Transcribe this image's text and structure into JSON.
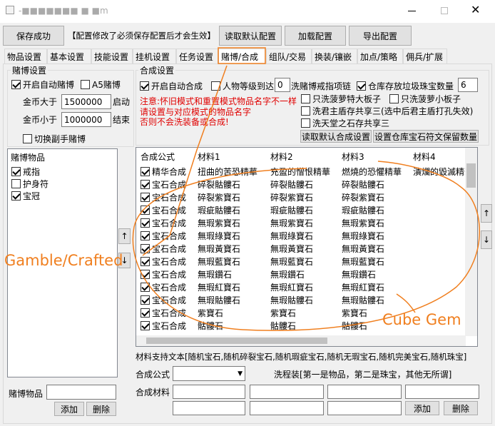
{
  "window": {
    "title": "-■■■■■■■ ■ ■m"
  },
  "toolbar": {
    "save_success": "保存成功",
    "notice": "【配置修改了必须保存配置后才会生效】",
    "read_default": "读取默认配置",
    "load_config": "加载配置",
    "export_config": "导出配置"
  },
  "tabs": [
    "物品设置",
    "基本设置",
    "技能设置",
    "挂机设置",
    "任务设置",
    "赌博/合成",
    "组队/交易",
    "换装/镶嵌",
    "加点/策略",
    "佣兵/扩展"
  ],
  "gamble": {
    "group_title": "赌博设置",
    "auto_gamble": "开启自动赌博",
    "a5_gamble": "A5赌博",
    "gold_gt_label": "金币大于",
    "gold_gt_value": "1500000",
    "start_label": "启动",
    "gold_lt_label": "金币小于",
    "gold_lt_value": "1000000",
    "end_label": "结束",
    "switch_weapon": "切换副手赌博",
    "items_header": "赌博物品",
    "items": [
      {
        "label": "戒指",
        "checked": true
      },
      {
        "label": "护身符",
        "checked": false
      },
      {
        "label": "宝冠",
        "checked": true
      }
    ],
    "item_label": "赌博物品",
    "add": "添加",
    "delete": "删除"
  },
  "craft": {
    "group_title": "合成设置",
    "auto_craft": "开启自动合成",
    "level_label": "人物等级到达",
    "level_value": "0",
    "wash_ring": "洗赌博戒指项链",
    "stash_trash": "仓库存放垃圾珠宝数量",
    "stash_value": "6",
    "wash_big_belt": "只洗菠萝特大板子",
    "wash_small_belt": "只洗菠萝小板子",
    "wash_shield": "洗君主盾存共享三(选中后君主盾打孔失效)",
    "wash_stone": "洗天堂之石存共享三",
    "warn1": "注意:怀旧模式和重置模式物品名字不一样",
    "warn2": "请设置与对应模式的物品名字",
    "warn3": "否则不会洗装备或合成!",
    "read_default_craft": "读取默认合成设置",
    "set_stash": "设置仓库宝石符文保留数量",
    "headers": [
      "合成公式",
      "材料1",
      "材料2",
      "材料3",
      "材料4"
    ],
    "rows": [
      [
        "精华合成",
        "扭曲的苦恐精華",
        "充盈的憎恨精華",
        "燃燒的恐懼精華",
        "潰爛的毀滅精華"
      ],
      [
        "宝石合成",
        "碎裂骷髏石",
        "碎裂骷髏石",
        "碎裂骷髏石",
        ""
      ],
      [
        "宝石合成",
        "碎裂紫寶石",
        "碎裂紫寶石",
        "碎裂紫寶石",
        ""
      ],
      [
        "宝石合成",
        "瑕疵骷髏石",
        "瑕疵骷髏石",
        "瑕疵骷髏石",
        ""
      ],
      [
        "宝石合成",
        "無瑕紫寶石",
        "無瑕紫寶石",
        "無瑕紫寶石",
        ""
      ],
      [
        "宝石合成",
        "無瑕綠寶石",
        "無瑕綠寶石",
        "無瑕綠寶石",
        ""
      ],
      [
        "宝石合成",
        "無瑕黃寶石",
        "無瑕黃寶石",
        "無瑕黃寶石",
        ""
      ],
      [
        "宝石合成",
        "無瑕藍寶石",
        "無瑕藍寶石",
        "無瑕藍寶石",
        ""
      ],
      [
        "宝石合成",
        "無瑕鑽石",
        "無瑕鑽石",
        "無瑕鑽石",
        ""
      ],
      [
        "宝石合成",
        "無瑕紅寶石",
        "無瑕紅寶石",
        "無瑕紅寶石",
        ""
      ],
      [
        "宝石合成",
        "無瑕骷髏石",
        "無瑕骷髏石",
        "無瑕骷髏石",
        ""
      ],
      [
        "宝石合成",
        "紫寶石",
        "紫寶石",
        "紫寶石",
        ""
      ],
      [
        "宝石合成",
        "骷髏石",
        "骷髏石",
        "骷髏石",
        ""
      ]
    ],
    "support_text": "材料支持文本[随机宝石,随机碎裂宝石,随机瑕疵宝石,随机无瑕宝石,随机完美宝石,随机珠宝]",
    "formula_label": "合成公式",
    "wash_note": "洗程装[第一是物品，第二是珠宝，其他无所谓]",
    "material_label": "合成材料",
    "add": "添加",
    "delete": "删除"
  },
  "annotations": {
    "left": "Gamble/Crafted",
    "right": "Cube Gem",
    "color": "#f07f1f"
  }
}
